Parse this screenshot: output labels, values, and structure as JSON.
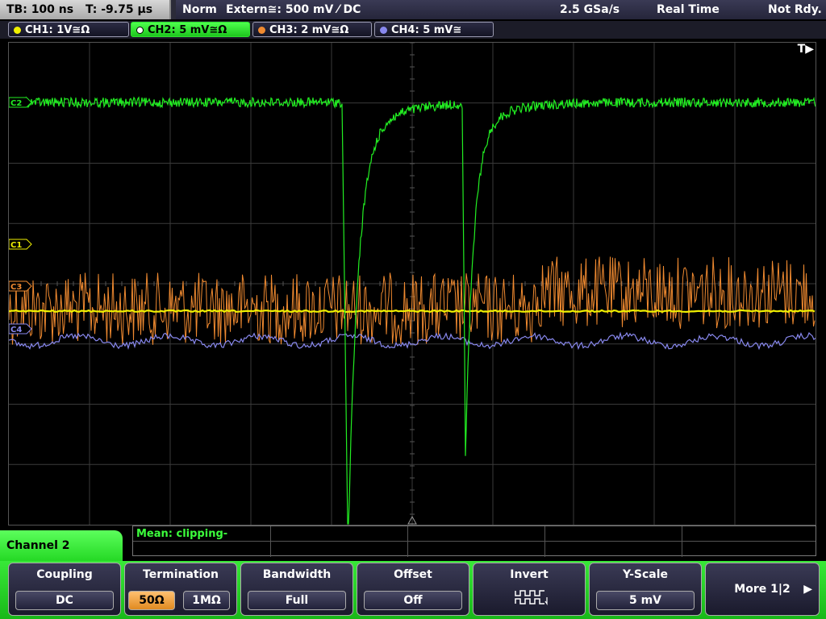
{
  "topbar": {
    "timebase": "TB: 100 ns",
    "trigger_time": "T: -9.75 µs",
    "mode": "Norm",
    "trigger_source": "Extern≅: 500 mV ⁄ DC",
    "sample_rate": "2.5 GSa/s",
    "acq_mode": "Real Time",
    "status": "Not Rdy."
  },
  "channels": [
    {
      "label": "CH1: 1V≅Ω",
      "color": "#f0f000",
      "active": false
    },
    {
      "label": "CH2: 5 mV≅Ω",
      "color": "#22ee22",
      "active": true
    },
    {
      "label": "CH3: 2 mV≅Ω",
      "color": "#f08a30",
      "active": false
    },
    {
      "label": "CH4: 5 mV≅",
      "color": "#8888ee",
      "active": false
    }
  ],
  "screen": {
    "trigger_marker": "T▶",
    "markers": [
      "C2",
      "C1",
      "C3",
      "C4"
    ]
  },
  "measurement": {
    "text": "Mean: clipping-"
  },
  "menu": {
    "title": "Channel 2",
    "coupling": {
      "label": "Coupling",
      "value": "DC"
    },
    "termination": {
      "label": "Termination",
      "options": [
        "50Ω",
        "1MΩ"
      ],
      "selected": "50Ω"
    },
    "bandwidth": {
      "label": "Bandwidth",
      "value": "Full"
    },
    "offset": {
      "label": "Offset",
      "value": "Off"
    },
    "invert": {
      "label": "Invert",
      "icon": "invert-waveform-icon"
    },
    "yscale": {
      "label": "Y-Scale",
      "value": "5 mV"
    },
    "more": {
      "label": "More 1|2",
      "icon": "arrow-right-icon"
    }
  }
}
